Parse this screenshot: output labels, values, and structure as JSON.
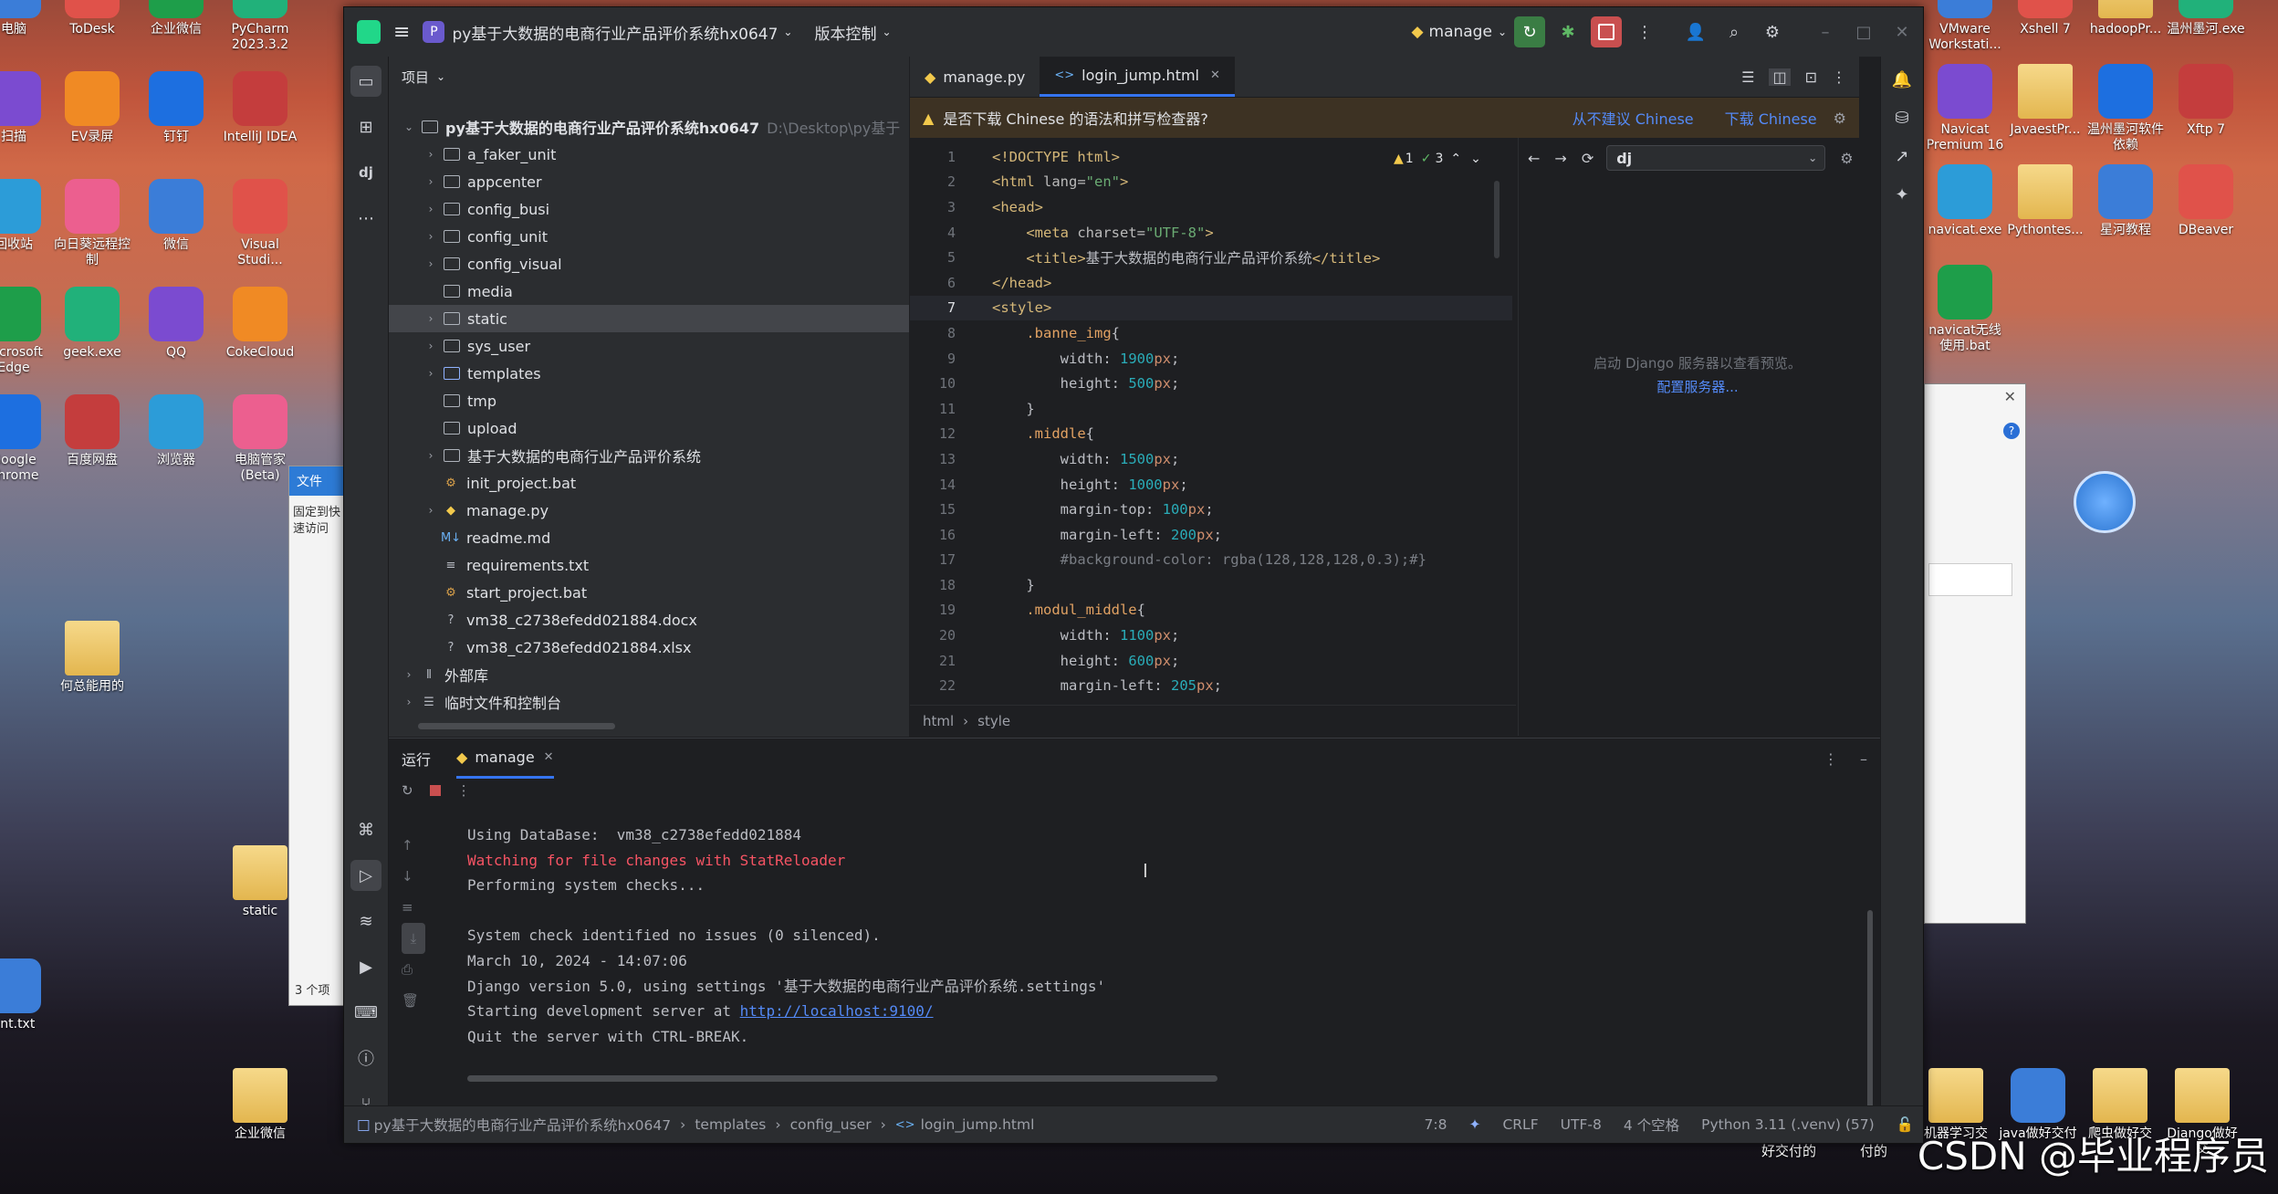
{
  "desktop": {
    "left_icons": [
      {
        "label": "电脑",
        "icon": "computer-icon"
      },
      {
        "label": "ToDesk",
        "icon": "todesk-icon"
      },
      {
        "label": "企业微信",
        "icon": "wecom-icon"
      },
      {
        "label": "PyCharm 2023.3.2",
        "icon": "pycharm-icon"
      },
      {
        "label": "扫描",
        "icon": "scan-icon"
      },
      {
        "label": "EV录屏",
        "icon": "ev-recorder-icon"
      },
      {
        "label": "钉钉",
        "icon": "dingtalk-icon"
      },
      {
        "label": "IntelliJ IDEA",
        "icon": "intellij-icon"
      },
      {
        "label": "回收站",
        "icon": "recycle-bin-icon"
      },
      {
        "label": "向日葵远程控制",
        "icon": "sunlogin-icon"
      },
      {
        "label": "微信",
        "icon": "wechat-icon"
      },
      {
        "label": "Visual Studi...",
        "icon": "vscode-icon"
      },
      {
        "label": "Microsoft Edge",
        "icon": "edge-icon"
      },
      {
        "label": "geek.exe",
        "icon": "geek-icon"
      },
      {
        "label": "QQ",
        "icon": "qq-icon"
      },
      {
        "label": "CokeCloud",
        "icon": "cokecloud-icon"
      },
      {
        "label": "Google Chrome",
        "icon": "chrome-icon"
      },
      {
        "label": "百度网盘",
        "icon": "baidu-netdisk-icon"
      },
      {
        "label": "浏览器",
        "icon": "browser-icon"
      },
      {
        "label": "电脑管家(Beta)",
        "icon": "pc-manager-icon"
      },
      {
        "label": "何总能用的",
        "icon": "folder-icon"
      },
      {
        "label": "static",
        "icon": "folder-icon"
      },
      {
        "label": "企业微信",
        "icon": "folder-icon"
      },
      {
        "label": "ent.txt",
        "icon": "text-file-icon"
      }
    ],
    "right_icons": [
      {
        "label": "VMware Workstati...",
        "icon": "vmware-icon"
      },
      {
        "label": "Xshell 7",
        "icon": "xshell-icon"
      },
      {
        "label": "hadoopPr...",
        "icon": "folder-icon"
      },
      {
        "label": "温州墨河.exe",
        "icon": "exe-icon"
      },
      {
        "label": "Navicat Premium 16",
        "icon": "navicat-icon"
      },
      {
        "label": "JavaestPr...",
        "icon": "folder-icon"
      },
      {
        "label": "温州墨河软件依赖",
        "icon": "exe-icon"
      },
      {
        "label": "Xftp 7",
        "icon": "xftp-icon"
      },
      {
        "label": "navicat.exe",
        "icon": "navicat-exe-icon"
      },
      {
        "label": "Pythontes...",
        "icon": "folder-icon"
      },
      {
        "label": "星河教程",
        "icon": "doc-icon"
      },
      {
        "label": "DBeaver",
        "icon": "dbeaver-icon"
      },
      {
        "label": "navicat无线使用.bat",
        "icon": "bat-icon"
      },
      {
        "label": "机器学习交",
        "icon": "folder-icon"
      },
      {
        "label": "java做好交付",
        "icon": "rar-icon"
      },
      {
        "label": "爬虫做好交",
        "icon": "folder-icon"
      },
      {
        "label": "Django做好交",
        "icon": "folder-icon"
      }
    ],
    "bottom_text": [
      "好交付的",
      "付的"
    ],
    "explorer_label": "文件",
    "explorer_items": [
      "固定到快速访问",
      "3 个项"
    ],
    "watermark": "CSDN @毕业程序员"
  },
  "ide": {
    "title": {
      "project_badge": "P",
      "project_name": "py基于大数据的电商行业产品评价系统hx0647",
      "vcs": "版本控制",
      "run_config": "manage"
    },
    "project_panel": {
      "header": "项目",
      "root_name": "py基于大数据的电商行业产品评价系统hx0647",
      "root_path": "D:\\Desktop\\py基于",
      "items": [
        {
          "label": "a_faker_unit",
          "type": "folder",
          "expandable": true
        },
        {
          "label": "appcenter",
          "type": "folder",
          "expandable": true
        },
        {
          "label": "config_busi",
          "type": "folder",
          "expandable": true
        },
        {
          "label": "config_unit",
          "type": "folder",
          "expandable": true
        },
        {
          "label": "config_visual",
          "type": "folder",
          "expandable": true
        },
        {
          "label": "media",
          "type": "folder",
          "expandable": false
        },
        {
          "label": "static",
          "type": "folder",
          "expandable": true,
          "selected": true
        },
        {
          "label": "sys_user",
          "type": "folder",
          "expandable": true
        },
        {
          "label": "templates",
          "type": "folder-blue",
          "expandable": true
        },
        {
          "label": "tmp",
          "type": "folder",
          "expandable": false
        },
        {
          "label": "upload",
          "type": "folder",
          "expandable": false
        },
        {
          "label": "基于大数据的电商行业产品评价系统",
          "type": "folder",
          "expandable": true
        },
        {
          "label": "init_project.bat",
          "type": "bat",
          "expandable": false
        },
        {
          "label": "manage.py",
          "type": "py",
          "expandable": true
        },
        {
          "label": "readme.md",
          "type": "md",
          "expandable": false
        },
        {
          "label": "requirements.txt",
          "type": "txt",
          "expandable": false
        },
        {
          "label": "start_project.bat",
          "type": "bat",
          "expandable": false
        },
        {
          "label": "vm38_c2738efedd021884.docx",
          "type": "unknown",
          "expandable": false
        },
        {
          "label": "vm38_c2738efedd021884.xlsx",
          "type": "unknown",
          "expandable": false
        }
      ],
      "external": "外部库",
      "scratches": "临时文件和控制台"
    },
    "tabs": [
      {
        "label": "manage.py",
        "icon": "python-file-icon"
      },
      {
        "label": "login_jump.html",
        "icon": "html-file-icon",
        "active": true
      }
    ],
    "banner": {
      "message": "是否下载 Chinese 的语法和拼写检查器?",
      "action1": "从不建议 Chinese",
      "action2": "下载 Chinese"
    },
    "inspection": {
      "warnings": "1",
      "checks": "3"
    },
    "code_lines": [
      {
        "n": "1",
        "html": "<span class='tag'>&lt;!DOCTYPE html&gt;</span>"
      },
      {
        "n": "2",
        "html": "<span class='tag'>&lt;html </span><span class='attr'>lang=</span><span class='str'>\"en\"</span><span class='tag'>&gt;</span>"
      },
      {
        "n": "3",
        "html": "<span class='tag'>&lt;head&gt;</span>"
      },
      {
        "n": "4",
        "html": "    <span class='tag'>&lt;meta </span><span class='attr'>charset=</span><span class='str'>\"UTF-8\"</span><span class='tag'>&gt;</span>"
      },
      {
        "n": "5",
        "html": "    <span class='tag'>&lt;title&gt;</span><span class='txt'>基于大数据的电商行业产品评价系统</span><span class='tag'>&lt;/title&gt;</span>"
      },
      {
        "n": "6",
        "html": "<span class='tag'>&lt;/head&gt;</span>"
      },
      {
        "n": "7",
        "html": "<span class='tag'>&lt;style&gt;</span>",
        "cur": true
      },
      {
        "n": "8",
        "html": "    <span class='sel'>.banne_img</span><span class='txt'>{</span>"
      },
      {
        "n": "9",
        "html": "        <span class='prop'>width: </span><span class='num'>1900</span><span class='unit'>px</span><span class='txt'>;</span>"
      },
      {
        "n": "10",
        "html": "        <span class='prop'>height: </span><span class='num'>500</span><span class='unit'>px</span><span class='txt'>;</span>"
      },
      {
        "n": "11",
        "html": "    <span class='txt'>}</span>"
      },
      {
        "n": "12",
        "html": "    <span class='sel'>.middle</span><span class='txt'>{</span>"
      },
      {
        "n": "13",
        "html": "        <span class='prop'>width: </span><span class='num'>1500</span><span class='unit'>px</span><span class='txt'>;</span>"
      },
      {
        "n": "14",
        "html": "        <span class='prop'>height: </span><span class='num'>1000</span><span class='unit'>px</span><span class='txt'>;</span>"
      },
      {
        "n": "15",
        "html": "        <span class='prop'>margin-top: </span><span class='num'>100</span><span class='unit'>px</span><span class='txt'>;</span>"
      },
      {
        "n": "16",
        "html": "        <span class='prop'>margin-left: </span><span class='num'>200</span><span class='unit'>px</span><span class='txt'>;</span>"
      },
      {
        "n": "17",
        "html": "        <span class='cmt'>#background-color: rgba(128,128,128,0.3);#}</span>"
      },
      {
        "n": "18",
        "html": "    <span class='txt'>}</span>"
      },
      {
        "n": "19",
        "html": "    <span class='sel'>.modul_middle</span><span class='txt'>{</span>"
      },
      {
        "n": "20",
        "html": "        <span class='prop'>width: </span><span class='num'>1100</span><span class='unit'>px</span><span class='txt'>;</span>"
      },
      {
        "n": "21",
        "html": "        <span class='prop'>height: </span><span class='num'>600</span><span class='unit'>px</span><span class='txt'>;</span>"
      },
      {
        "n": "22",
        "html": "        <span class='prop'>margin-left: </span><span class='num'>205</span><span class='unit'>px</span><span class='txt'>;</span>"
      }
    ],
    "editor_breadcrumb": [
      "html",
      "style"
    ],
    "preview": {
      "search_value": "dj",
      "message": "启动 Django 服务器以查看预览。",
      "link": "配置服务器..."
    },
    "run": {
      "label": "运行",
      "tab": "manage",
      "lines": [
        {
          "text": "Using DataBase:  vm38_c2738efedd021884",
          "cls": ""
        },
        {
          "text": "Watching for file changes with StatReloader",
          "cls": "red"
        },
        {
          "text": "Performing system checks...",
          "cls": ""
        },
        {
          "text": "",
          "cls": ""
        },
        {
          "text": "System check identified no issues (0 silenced).",
          "cls": ""
        },
        {
          "text": "March 10, 2024 - 14:07:06",
          "cls": ""
        },
        {
          "text": "Django version 5.0, using settings '基于大数据的电商行业产品评价系统.settings'",
          "cls": ""
        },
        {
          "text": "Starting development server at ",
          "cls": "",
          "link": "http://localhost:9100/"
        },
        {
          "text": "Quit the server with CTRL-BREAK.",
          "cls": ""
        }
      ]
    },
    "status": {
      "path": [
        "py基于大数据的电商行业产品评价系统hx0647",
        "templates",
        "config_user",
        "login_jump.html"
      ],
      "position": "7:8",
      "line_sep": "CRLF",
      "encoding": "UTF-8",
      "indent": "4 个空格",
      "interpreter": "Python 3.11 (.venv) (57)"
    }
  }
}
